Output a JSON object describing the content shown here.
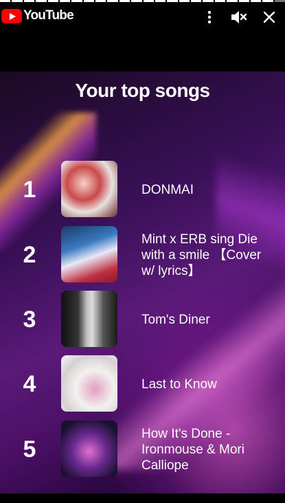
{
  "header": {
    "brand": "YouTube",
    "progress_segments": 24,
    "progress_done": 23
  },
  "icons": {
    "logo": "youtube-logo-icon",
    "more": "more-vertical-icon",
    "mute": "muted-speaker-icon",
    "close": "close-icon"
  },
  "card": {
    "title": "Your top songs",
    "songs": [
      {
        "rank": "1",
        "title": "DONMAI"
      },
      {
        "rank": "2",
        "title": "Mint x ERB sing Die with a smile 【Cover w/ lyrics】"
      },
      {
        "rank": "3",
        "title": "Tom's Diner"
      },
      {
        "rank": "4",
        "title": "Last to Know"
      },
      {
        "rank": "5",
        "title": "How It's Done - Ironmouse & Mori Calliope"
      }
    ]
  }
}
